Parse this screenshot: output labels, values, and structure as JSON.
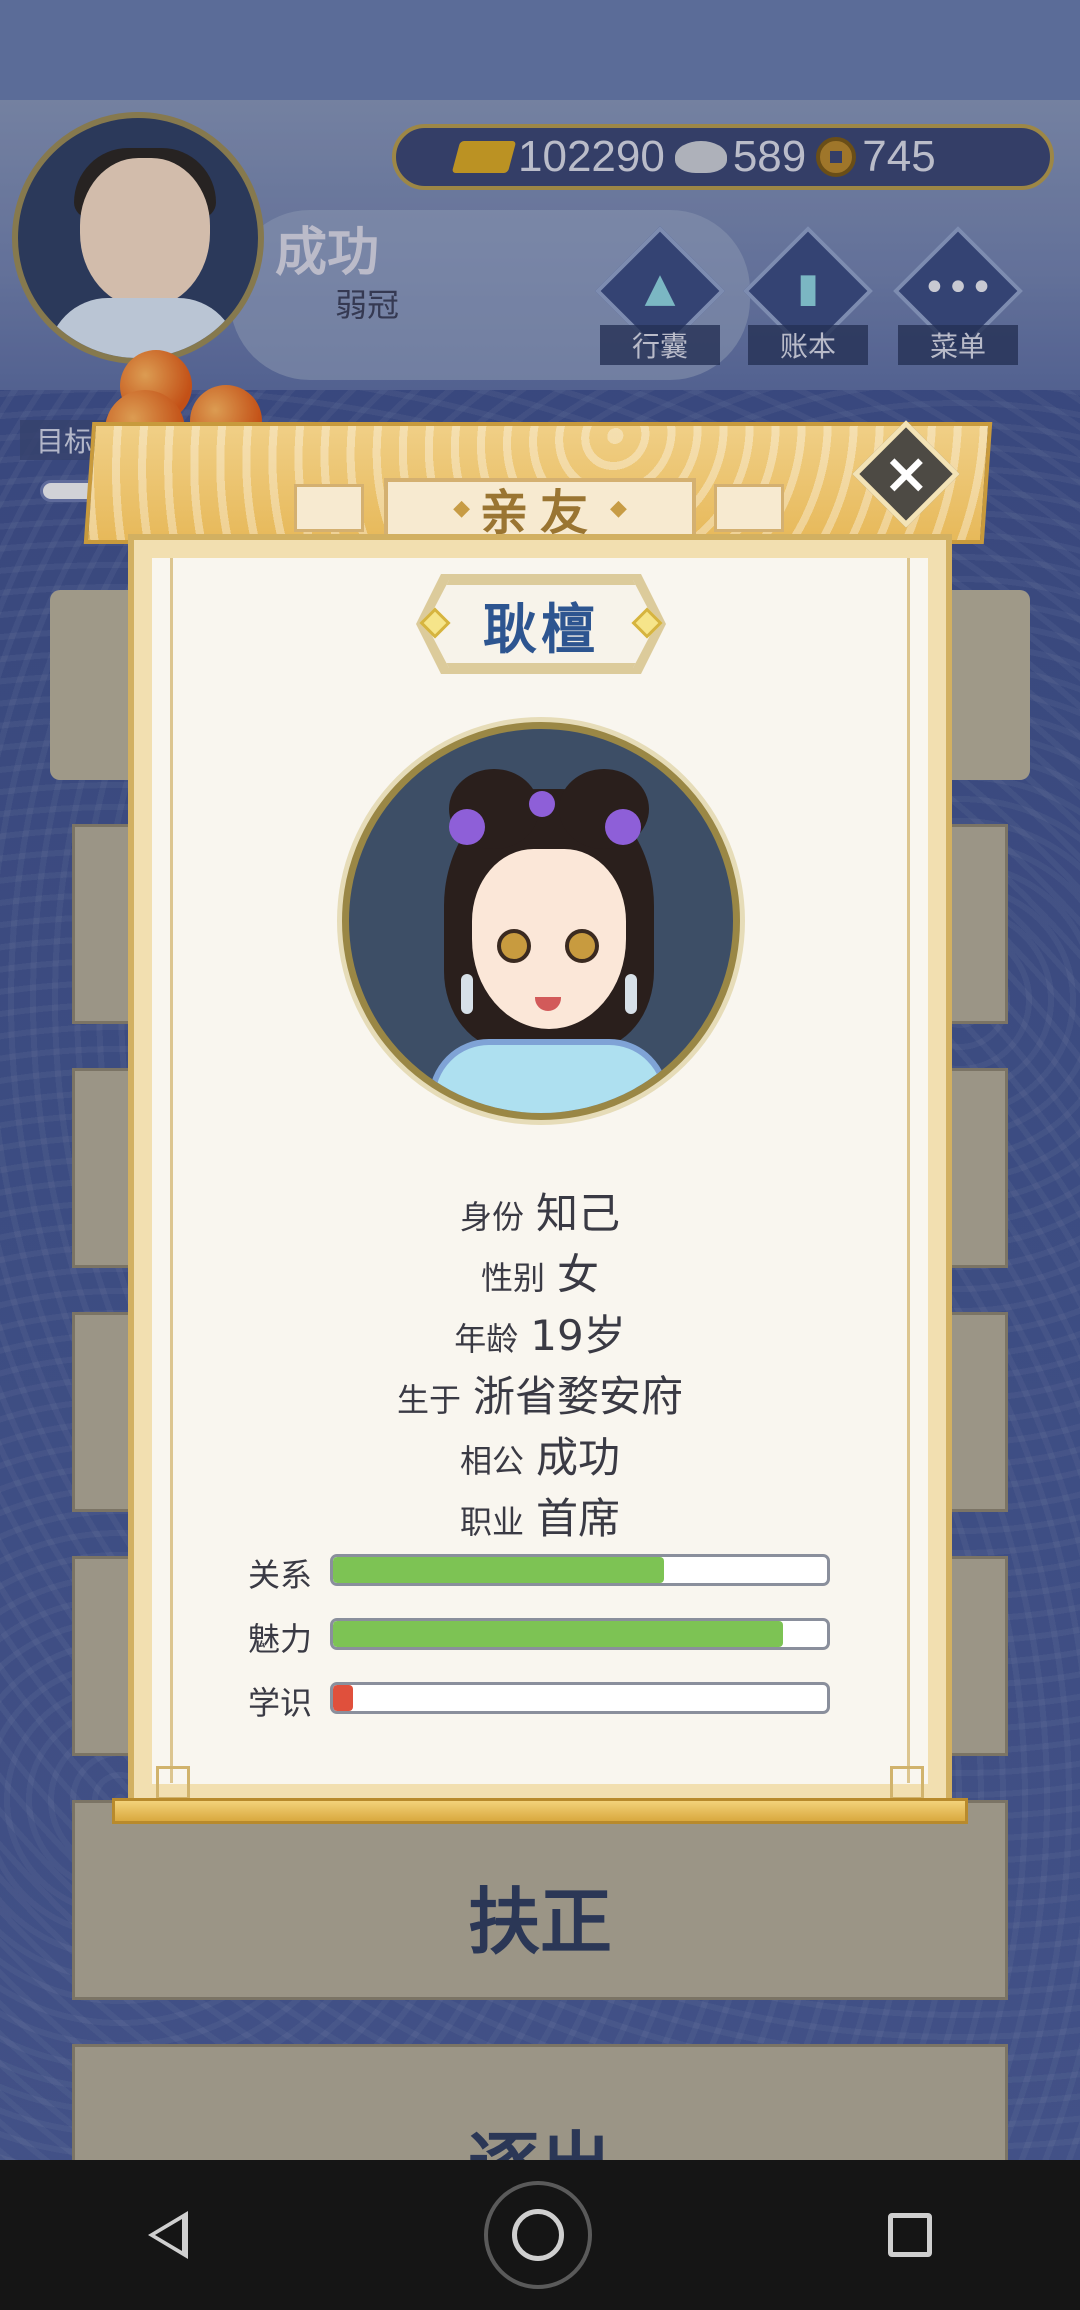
{
  "player": {
    "name": "成功",
    "rank": "弱冠"
  },
  "currency": {
    "gold": "102290",
    "silver": "589",
    "coins": "745"
  },
  "top_menu": [
    {
      "label": "行囊",
      "icon": "bag-icon"
    },
    {
      "label": "账本",
      "icon": "ledger-icon"
    },
    {
      "label": "菜单",
      "icon": "menu-dots-icon"
    }
  ],
  "goal": {
    "label": "目标"
  },
  "actions": {
    "promote": "扶正",
    "expel": "逐出"
  },
  "modal": {
    "title": "亲友",
    "character_name": "耿檀",
    "info": [
      {
        "key": "身份",
        "value": "知己"
      },
      {
        "key": "性别",
        "value": "女"
      },
      {
        "key": "年龄",
        "value": "19岁"
      },
      {
        "key": "生于",
        "value": "浙省婺安府"
      },
      {
        "key": "相公",
        "value": "成功"
      },
      {
        "key": "职业",
        "value": "首席"
      }
    ],
    "stats": [
      {
        "label": "关系",
        "level": 0.67,
        "color": "#7dc354"
      },
      {
        "label": "魅力",
        "level": 0.91,
        "color": "#7dc354"
      },
      {
        "label": "学识",
        "level": 0.04,
        "color": "#e0503c"
      }
    ]
  },
  "colors": {
    "accent_gold": "#d2b061",
    "name_blue": "#2d5590",
    "bar_green": "#7dc354",
    "bar_red": "#e0503c"
  },
  "nav": {
    "back": "back-icon",
    "home": "home-icon",
    "recent": "recent-apps-icon"
  }
}
